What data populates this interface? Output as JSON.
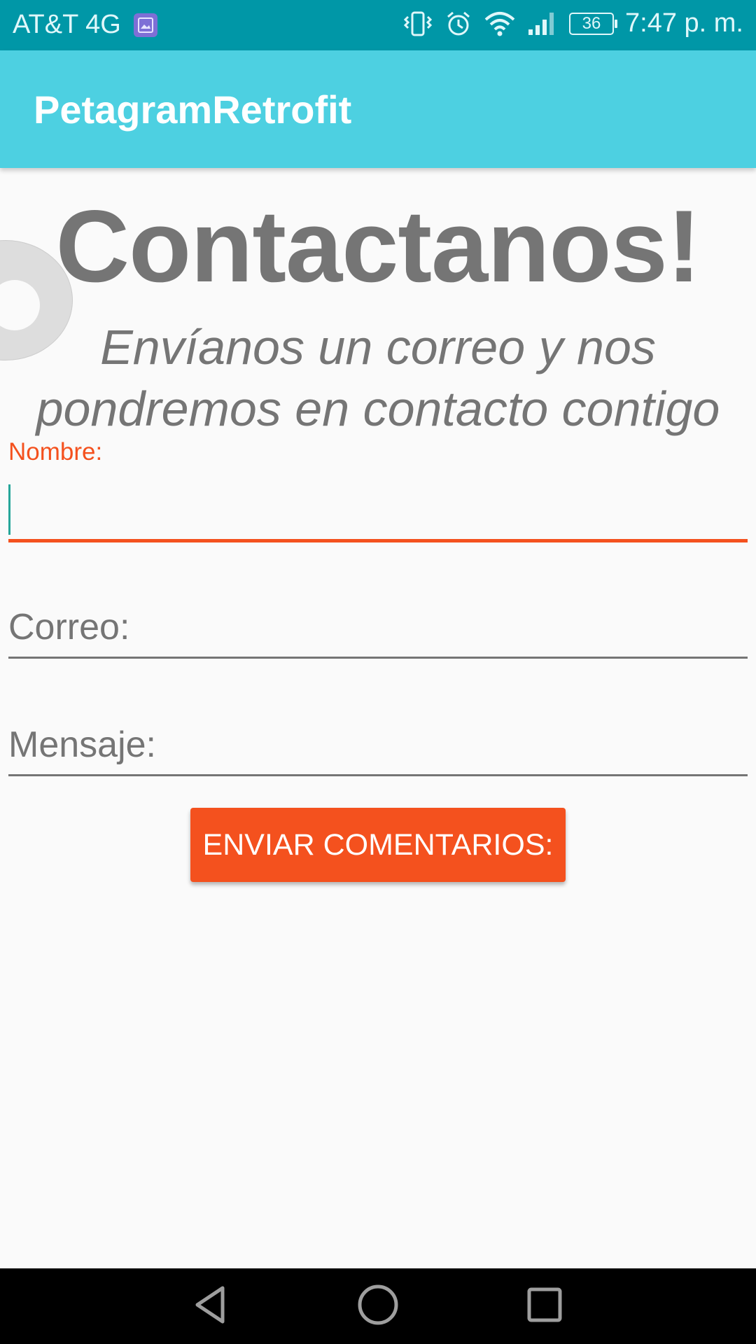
{
  "status_bar": {
    "carrier": "AT&T 4G",
    "battery_level": "36",
    "time": "7:47 p. m.",
    "icons": [
      "gallery-notification-icon",
      "vibrate-icon",
      "alarm-icon",
      "wifi-icon",
      "signal-icon",
      "battery-icon"
    ]
  },
  "app_bar": {
    "title": "PetagramRetrofit"
  },
  "content": {
    "heading": "Contactanos!",
    "subheading": "Envíanos un correo y nos pondremos en contacto contigo"
  },
  "form": {
    "name_label": "Nombre:",
    "name_value": "",
    "email_label": "Correo:",
    "message_label": "Mensaje:",
    "submit_label": "ENVIAR COMENTARIOS:"
  },
  "colors": {
    "status_bar": "#0097a7",
    "app_bar": "#4dd0e1",
    "accent": "#f4511e",
    "text_gray": "#757575"
  },
  "nav_bar": {
    "icons": [
      "back-icon",
      "home-icon",
      "recents-icon"
    ]
  }
}
